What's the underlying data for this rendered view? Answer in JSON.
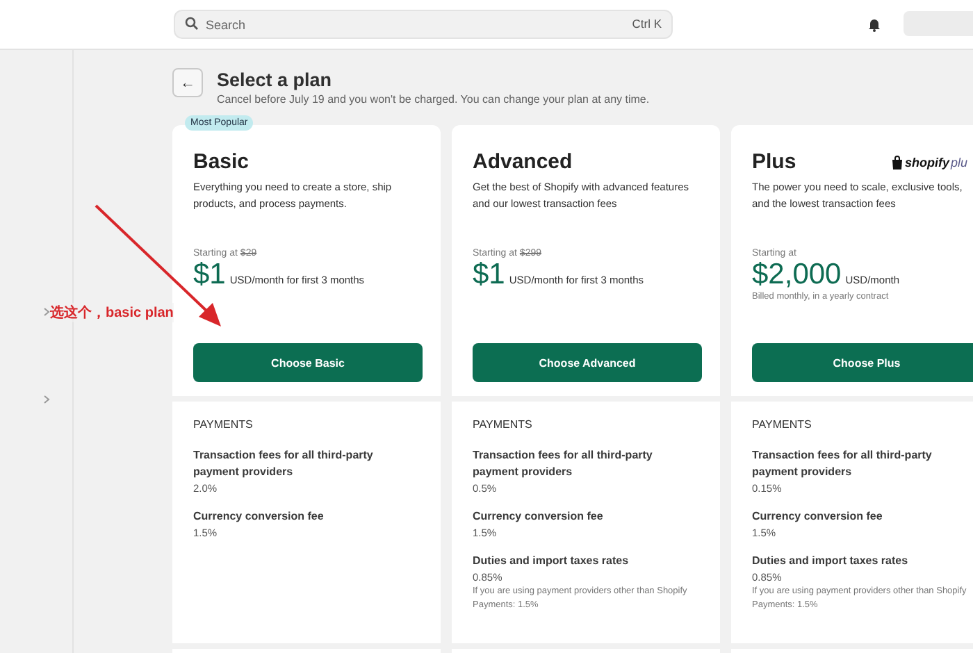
{
  "topbar": {
    "search": {
      "placeholder": "Search",
      "shortcut": "Ctrl K"
    }
  },
  "header": {
    "back": "←",
    "title": "Select a plan",
    "subtitle": "Cancel before July 19 and you won't be charged. You can change your plan at any time."
  },
  "annotation": {
    "text": "选这个，basic plan"
  },
  "plans": [
    {
      "badge": "Most Popular",
      "name": "Basic",
      "description": "Everything you need to create a store, ship products, and process payments.",
      "starting": "Starting at",
      "old_price": "$29",
      "price": "$1",
      "unit": "USD/month for first 3 months",
      "button": "Choose Basic",
      "section": "PAYMENTS",
      "fees": [
        {
          "label": "Transaction fees for all third-party payment providers",
          "value": "2.0%"
        },
        {
          "label": "Currency conversion fee",
          "value": "1.5%"
        }
      ]
    },
    {
      "name": "Advanced",
      "description": "Get the best of Shopify with advanced features and our lowest transaction fees",
      "starting": "Starting at",
      "old_price": "$299",
      "price": "$1",
      "unit": "USD/month for first 3 months",
      "button": "Choose Advanced",
      "section": "PAYMENTS",
      "fees": [
        {
          "label": "Transaction fees for all third-party payment providers",
          "value": "0.5%"
        },
        {
          "label": "Currency conversion fee",
          "value": "1.5%"
        },
        {
          "label": "Duties and import taxes rates",
          "value": "0.85%",
          "note": "If you are using payment providers other than Shopify Payments: 1.5%"
        }
      ]
    },
    {
      "name": "Plus",
      "logo_text": "shopify",
      "logo_suffix": "plu",
      "description": "The power you need to scale, exclusive tools, and the lowest transaction fees",
      "starting": "Starting at",
      "price": "$2,000",
      "unit": "USD/month",
      "billing": "Billed monthly, in a yearly contract",
      "button": "Choose Plus",
      "section": "PAYMENTS",
      "fees": [
        {
          "label": "Transaction fees for all third-party payment providers",
          "value": "0.15%"
        },
        {
          "label": "Currency conversion fee",
          "value": "1.5%"
        },
        {
          "label": "Duties and import taxes rates",
          "value": "0.85%",
          "note": "If you are using payment providers other than Shopify Payments: 1.5%"
        }
      ]
    }
  ]
}
